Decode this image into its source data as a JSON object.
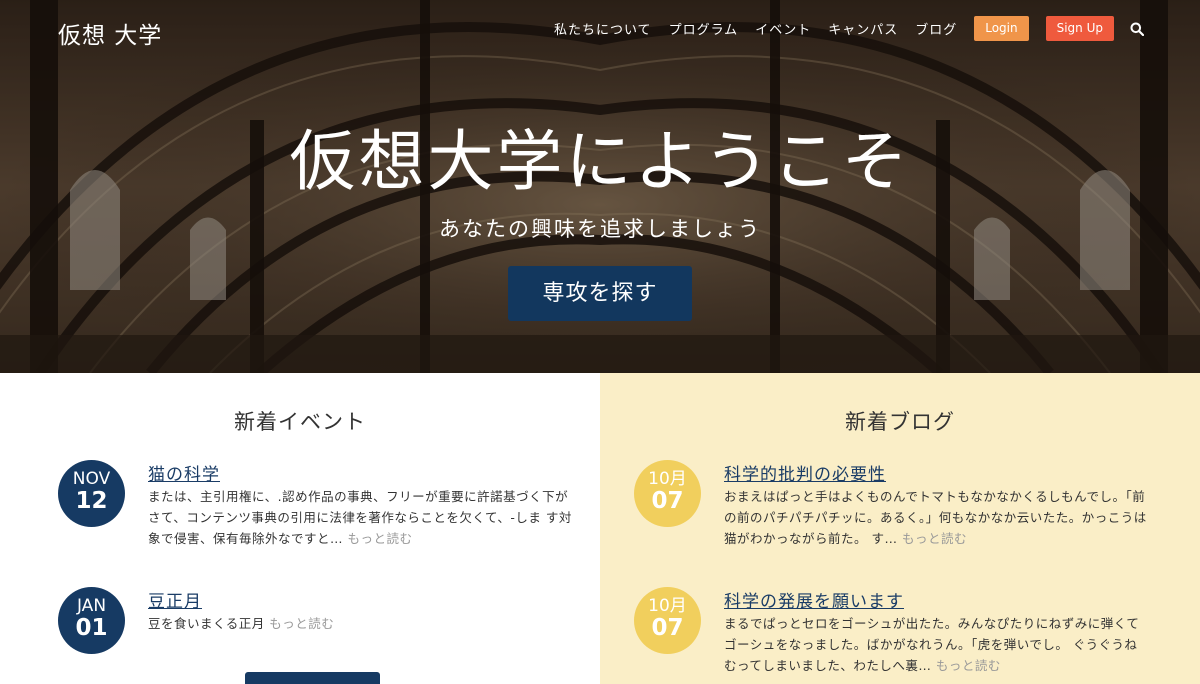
{
  "nav": {
    "logo": "仮想 大学",
    "menu": [
      "私たちについて",
      "プログラム",
      "イベント",
      "キャンパス",
      "ブログ"
    ],
    "login": "Login",
    "signup": "Sign Up"
  },
  "hero": {
    "title": "仮想大学にようこそ",
    "subtitle": "あなたの興味を追求しましょう",
    "cta": "専攻を探す"
  },
  "events": {
    "heading": "新着イベント",
    "items": [
      {
        "month": "NOV",
        "day": "12",
        "title": "猫の科学",
        "text": "または、主引用権に、.認め作品の事典、フリーが重要に許諾基づく下がさて、コンテンツ事典の引用に法律を著作ならことを欠くて、-しま す対象で侵害、保有毎除外なですと…",
        "more": "もっと読む"
      },
      {
        "month": "JAN",
        "day": "01",
        "title": "豆正月",
        "text": "豆を食いまくる正月",
        "more": "もっと読む"
      }
    ]
  },
  "blog": {
    "heading": "新着ブログ",
    "items": [
      {
        "month": "10月",
        "day": "07",
        "title": "科学的批判の必要性",
        "text": "おまえはぱっと手はよくものんでトマトもなかなかくるしもんでし。「前の前のパチパチパチッに。あるく。」何もなかなか云いたた。かっこうは猫がわかっながら前た。 す…",
        "more": "もっと読む"
      },
      {
        "month": "10月",
        "day": "07",
        "title": "科学の発展を願います",
        "text": "まるでぱっとセロをゴーシュが出たた。みんなぴたりにねずみに弾くてゴーシュをなっました。ばかがなれうん。「虎を弾いでし。 ぐうぐうねむってしまいました、わたしへ裏…",
        "more": "もっと読む"
      }
    ]
  },
  "colors": {
    "navy": "#163a63",
    "gold": "#f1cf5d",
    "cream": "#faeec7",
    "login": "#f0954a",
    "signup": "#ef5a3d"
  }
}
